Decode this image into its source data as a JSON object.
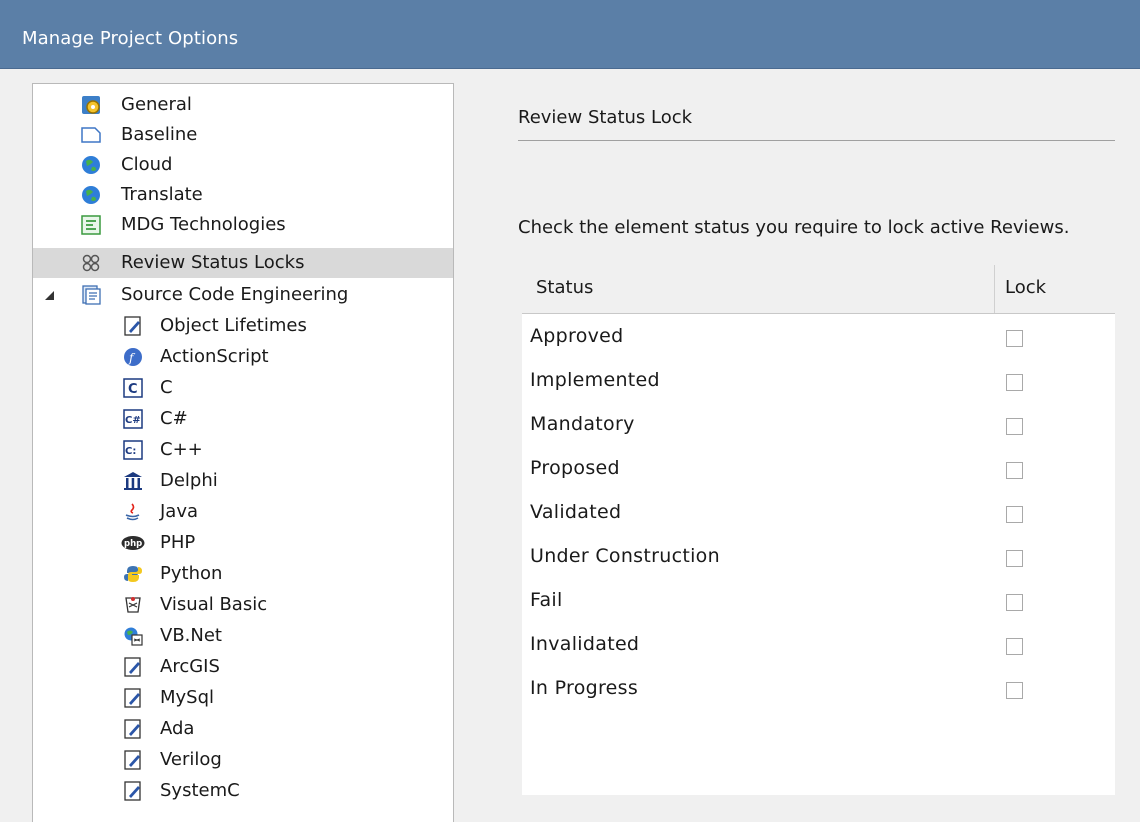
{
  "window": {
    "title": "Manage Project Options"
  },
  "tree": {
    "items": [
      {
        "label": "General",
        "icon": "general-icon"
      },
      {
        "label": "Baseline",
        "icon": "baseline-icon"
      },
      {
        "label": "Cloud",
        "icon": "cloud-globe-icon"
      },
      {
        "label": "Translate",
        "icon": "translate-globe-icon"
      },
      {
        "label": "MDG Technologies",
        "icon": "mdg-icon"
      },
      {
        "label": "Review Status Locks",
        "icon": "review-locks-icon",
        "selected": true
      },
      {
        "label": "Source Code Engineering",
        "icon": "source-code-icon",
        "expanded": true
      },
      {
        "label": "Object Lifetimes",
        "icon": "document-pen-icon"
      },
      {
        "label": "ActionScript",
        "icon": "actionscript-icon"
      },
      {
        "label": "C",
        "icon": "c-language-icon"
      },
      {
        "label": "C#",
        "icon": "csharp-icon"
      },
      {
        "label": "C++",
        "icon": "cpp-icon"
      },
      {
        "label": "Delphi",
        "icon": "delphi-icon"
      },
      {
        "label": "Java",
        "icon": "java-icon"
      },
      {
        "label": "PHP",
        "icon": "php-icon"
      },
      {
        "label": "Python",
        "icon": "python-icon"
      },
      {
        "label": "Visual Basic",
        "icon": "visual-basic-icon"
      },
      {
        "label": "VB.Net",
        "icon": "vbnet-icon"
      },
      {
        "label": "ArcGIS",
        "icon": "document-pen-icon"
      },
      {
        "label": "MySql",
        "icon": "document-pen-icon"
      },
      {
        "label": "Ada",
        "icon": "document-pen-icon"
      },
      {
        "label": "Verilog",
        "icon": "document-pen-icon"
      },
      {
        "label": "SystemC",
        "icon": "document-pen-icon"
      }
    ]
  },
  "panel": {
    "heading": "Review Status Lock",
    "instruction": "Check the element status you require to lock active Reviews.",
    "columns": {
      "status": "Status",
      "lock": "Lock"
    },
    "rows": [
      {
        "status": "Approved",
        "locked": false
      },
      {
        "status": "Implemented",
        "locked": false
      },
      {
        "status": "Mandatory",
        "locked": false
      },
      {
        "status": "Proposed",
        "locked": false
      },
      {
        "status": "Validated",
        "locked": false
      },
      {
        "status": "Under Construction",
        "locked": false
      },
      {
        "status": "Fail",
        "locked": false
      },
      {
        "status": "Invalidated",
        "locked": false
      },
      {
        "status": "In Progress",
        "locked": false
      }
    ]
  }
}
